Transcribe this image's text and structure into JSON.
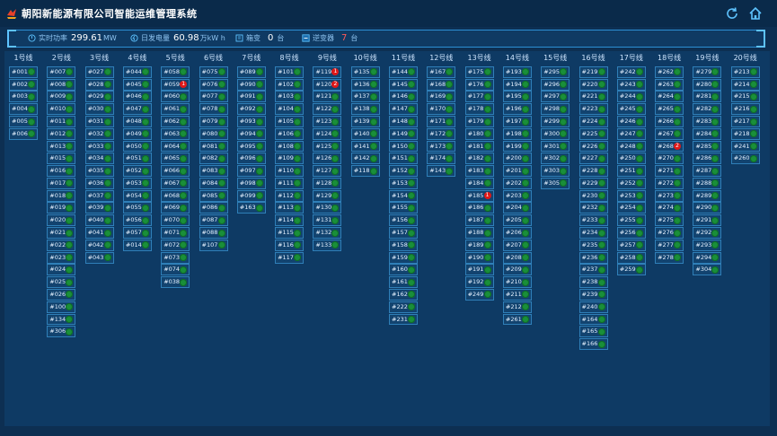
{
  "header": {
    "title": "朝阳新能源有限公司智能运维管理系统"
  },
  "stats": {
    "power_label": "实时功率",
    "power_value": "299.61",
    "power_unit": "MW",
    "energy_label": "日发电量",
    "energy_value": "60.98",
    "energy_unit": "万kW h",
    "box_label": "箱变",
    "box_value": "0",
    "box_unit": "台",
    "inverter_label": "逆变器",
    "inverter_value": "7",
    "inverter_unit": "台"
  },
  "colors": {
    "ok": "#1a8f3a",
    "alarm": "#e01818"
  },
  "lines": [
    {
      "label": "1号线",
      "items": [
        "#001",
        "#002",
        "#003",
        "#004",
        "#005",
        "#006"
      ]
    },
    {
      "label": "2号线",
      "items": [
        "#007",
        "#008",
        "#009",
        "#010",
        "#011",
        "#012",
        "#013",
        "#015",
        "#016",
        "#017",
        "#018",
        "#019",
        "#020",
        "#021",
        "#022",
        "#023",
        "#024",
        "#025",
        "#026",
        "#100",
        "#134",
        "#306"
      ]
    },
    {
      "label": "3号线",
      "items": [
        "#027",
        "#028",
        "#029",
        "#030",
        "#031",
        "#032",
        "#033",
        "#034",
        "#035",
        "#036",
        "#037",
        "#039",
        "#040",
        "#041",
        "#042",
        "#043"
      ]
    },
    {
      "label": "4号线",
      "items": [
        "#044",
        "#045",
        "#046",
        "#047",
        "#048",
        "#049",
        "#050",
        "#051",
        "#052",
        "#053",
        "#054",
        "#055",
        "#056",
        "#057",
        "#014"
      ]
    },
    {
      "label": "5号线",
      "items": [
        "#058",
        "#059",
        "#060",
        "#061",
        "#062",
        "#063",
        "#064",
        "#065",
        "#066",
        "#067",
        "#068",
        "#069",
        "#070",
        "#071",
        "#072",
        "#073",
        "#074",
        "#038"
      ],
      "alarms": {
        "1": "1"
      }
    },
    {
      "label": "6号线",
      "items": [
        "#075",
        "#076",
        "#077",
        "#078",
        "#079",
        "#080",
        "#081",
        "#082",
        "#083",
        "#084",
        "#085",
        "#086",
        "#087",
        "#088",
        "#107"
      ]
    },
    {
      "label": "7号线",
      "items": [
        "#089",
        "#090",
        "#091",
        "#092",
        "#093",
        "#094",
        "#095",
        "#096",
        "#097",
        "#098",
        "#099",
        "#163"
      ]
    },
    {
      "label": "8号线",
      "items": [
        "#101",
        "#102",
        "#103",
        "#104",
        "#105",
        "#106",
        "#108",
        "#109",
        "#110",
        "#111",
        "#112",
        "#113",
        "#114",
        "#115",
        "#116",
        "#117"
      ]
    },
    {
      "label": "9号线",
      "items": [
        "#119",
        "#120",
        "#121",
        "#122",
        "#123",
        "#124",
        "#125",
        "#126",
        "#127",
        "#128",
        "#129",
        "#130",
        "#131",
        "#132",
        "#133"
      ],
      "alarms": {
        "0": "1",
        "1": "2"
      }
    },
    {
      "label": "10号线",
      "items": [
        "#135",
        "#136",
        "#137",
        "#138",
        "#139",
        "#140",
        "#141",
        "#142",
        "#118"
      ]
    },
    {
      "label": "11号线",
      "items": [
        "#144",
        "#145",
        "#146",
        "#147",
        "#148",
        "#149",
        "#150",
        "#151",
        "#152",
        "#153",
        "#154",
        "#155",
        "#156",
        "#157",
        "#158",
        "#159",
        "#160",
        "#161",
        "#162",
        "#222",
        "#231"
      ]
    },
    {
      "label": "12号线",
      "items": [
        "#167",
        "#168",
        "#169",
        "#170",
        "#171",
        "#172",
        "#173",
        "#174",
        "#143"
      ]
    },
    {
      "label": "13号线",
      "items": [
        "#175",
        "#176",
        "#177",
        "#178",
        "#179",
        "#180",
        "#181",
        "#182",
        "#183",
        "#184",
        "#185",
        "#186",
        "#187",
        "#188",
        "#189",
        "#190",
        "#191",
        "#192",
        "#249"
      ],
      "alarms": {
        "10": "1"
      }
    },
    {
      "label": "14号线",
      "items": [
        "#193",
        "#194",
        "#195",
        "#196",
        "#197",
        "#198",
        "#199",
        "#200",
        "#201",
        "#202",
        "#203",
        "#204",
        "#205",
        "#206",
        "#207",
        "#208",
        "#209",
        "#210",
        "#211",
        "#212",
        "#261"
      ]
    },
    {
      "label": "15号线",
      "items": [
        "#295",
        "#296",
        "#297",
        "#298",
        "#299",
        "#300",
        "#301",
        "#302",
        "#303",
        "#305"
      ]
    },
    {
      "label": "16号线",
      "items": [
        "#219",
        "#220",
        "#221",
        "#223",
        "#224",
        "#225",
        "#226",
        "#227",
        "#228",
        "#229",
        "#230",
        "#232",
        "#233",
        "#234",
        "#235",
        "#236",
        "#237",
        "#238",
        "#239",
        "#240",
        "#164",
        "#165",
        "#166"
      ]
    },
    {
      "label": "17号线",
      "items": [
        "#242",
        "#243",
        "#244",
        "#245",
        "#246",
        "#247",
        "#248",
        "#250",
        "#251",
        "#252",
        "#253",
        "#254",
        "#255",
        "#256",
        "#257",
        "#258",
        "#259"
      ]
    },
    {
      "label": "18号线",
      "items": [
        "#262",
        "#263",
        "#264",
        "#265",
        "#266",
        "#267",
        "#268",
        "#270",
        "#271",
        "#272",
        "#273",
        "#274",
        "#275",
        "#276",
        "#277",
        "#278"
      ],
      "alarms": {
        "6": "2"
      }
    },
    {
      "label": "19号线",
      "items": [
        "#279",
        "#280",
        "#281",
        "#282",
        "#283",
        "#284",
        "#285",
        "#286",
        "#287",
        "#288",
        "#289",
        "#290",
        "#291",
        "#292",
        "#293",
        "#294",
        "#304"
      ]
    },
    {
      "label": "20号线",
      "items": [
        "#213",
        "#214",
        "#215",
        "#216",
        "#217",
        "#218",
        "#241",
        "#260"
      ]
    }
  ]
}
